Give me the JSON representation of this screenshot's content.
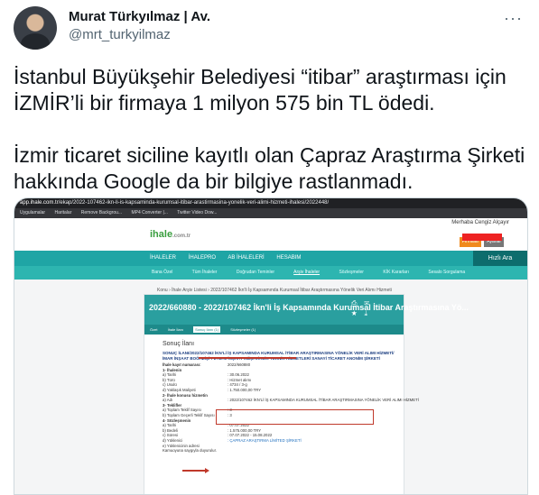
{
  "author": {
    "name": "Murat Türkyılmaz | Av.",
    "handle": "@mrt_turkyilmaz"
  },
  "more_icon": "more-horizontal-icon",
  "tweet": {
    "paragraph1": "İstanbul Büyükşehir Belediyesi “itibar” araştırması için İZMİR’li bir firmaya 1 milyon 575 bin TL ödedi.",
    "paragraph2": "İzmir ticaret siciline kayıtlı olan Çapraz Araştırma Şirketi hakkında Google da bir bilgiye rastlanmadı."
  },
  "screenshot": {
    "browser": {
      "host": "app.ihale.com.tr",
      "path": "/ekap/2022-107462-ikn-li-is-kapsaminda-kurumsal-itibar-arastirmasina-yonelik-veri-alimi-hizmeti-ihalesi/2022448/",
      "bookmarks": [
        "Uygulamalar",
        "Haritalar",
        "Remove Backgrou...",
        "MP4 Converter |...",
        "Twitter Video Dow..."
      ]
    },
    "site": {
      "logo": "ihale",
      "logo_suffix": ".com.tr",
      "greeting": "Merhaba Cengiz Alçayır",
      "top_buttons": [
        "Firmalar",
        "Ayarlar"
      ],
      "nav": [
        "İHALELER",
        "İHALEPRO",
        "AB İHALELERİ",
        "HESABIM"
      ],
      "quick_search": "Hızlı Ara",
      "subnav": [
        "Bana Özel",
        "Tüm İhaleler",
        "Doğrudan Teminler",
        "Arşiv İhaleler",
        "Sözleşmeler",
        "KİK Kararları",
        "Sesalo Sorgulama"
      ],
      "subnav_active": "Arşiv İhaleler",
      "breadcrumb": "Konu › İhale Arşiv Listesi › 2022/107462 İkn'li İş Kapsamında Kurumsal İtibar Araştırmasına Yönelik Veri Alımı Hizmeti"
    },
    "card": {
      "title": "2022/660880 - 2022/107462 İkn'li İş Kapsamında Kurumsal İtibar Araştırmasına Yö...",
      "icons": [
        "printer-icon",
        "mail-icon",
        "star-icon",
        "download-icon"
      ],
      "tabs": [
        "Özet",
        "İhale İlanı",
        "Sonuç İlanı (1)",
        "Sözleşmeler (1)"
      ],
      "tab_active": "Sonuç İlanı (1)",
      "section_title": "Sonuç İlanı",
      "heading": "SONUÇ İLANI/2022/107462 İKN'Lİ İŞ KAPSAMINDA KURUMSAL İTİBAR ARAŞTIRMASINA YÖNELİK VERİ ALIMI HİZMETİ/İMAR İNŞAAT BOĞAZİÇİ PEYZAJ İNŞAAT MÜŞAVİRLİK TEKNİK HİZMETLERİ SANAYİ TİCARET ANONİM ŞİRKETİ",
      "rows": [
        {
          "k": "İhale kayıt numarası:",
          "v": "2022/660880",
          "section": true
        },
        {
          "k": "1- İhalenin",
          "v": "",
          "section": true
        },
        {
          "k": "a) Tarihi",
          "v": ": 30.06.2022"
        },
        {
          "k": "b) Türü",
          "v": ": Hizmet alımı"
        },
        {
          "k": "c) Usulü",
          "v": ": 4734 / 3-g"
        },
        {
          "k": "d) Yaklaşık Maliyeti",
          "v": ": 1.750.000,00 TRY"
        },
        {
          "k": "2- İhale konusu hizmetin",
          "v": "",
          "section": true
        },
        {
          "k": "a) Adı",
          "v": ": 2022/107462 İKN'Lİ İŞ KAPSAMINDA KURUMSAL İTİBAR ARAŞTIRMASINA YÖNELİK VERİ ALIMI HİZMETİ"
        },
        {
          "k": "3- Teklifler",
          "v": "",
          "section": true
        },
        {
          "k": "a) Toplam Teklif Sayısı",
          "v": ": 3"
        },
        {
          "k": "b) Toplam Geçerli Teklif Sayısı",
          "v": ": 3"
        },
        {
          "k": "4- Sözleşmenin",
          "v": "",
          "section": true
        },
        {
          "k": "a) Tarihi",
          "v": ": 07.07.2022"
        },
        {
          "k": "b) Bedeli",
          "v": ": 1.575.000,00 TRY"
        },
        {
          "k": "c) Süresi",
          "v": ": 07.07.2022 - 15.08.2022"
        },
        {
          "k": "d) Yüklenici",
          "v": ": ÇAPRAZ ARAŞTIRMA LİMİTED ŞİRKETİ",
          "link": true
        },
        {
          "k": "e) Yüklenicinin adresi",
          "v": ""
        },
        {
          "k": "Kamuoyuna saygıyla duyurulur.",
          "v": ""
        }
      ]
    }
  }
}
